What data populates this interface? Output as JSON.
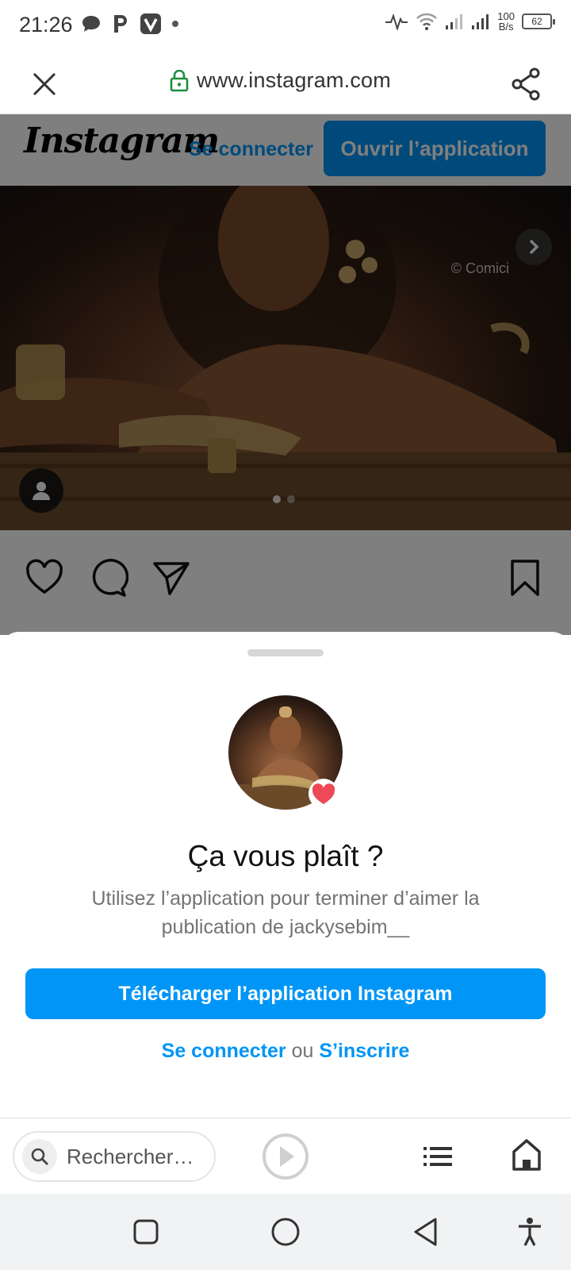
{
  "status_bar": {
    "time": "21:26",
    "net_speed_value": "100",
    "net_speed_unit": "B/s",
    "battery": "62"
  },
  "browser": {
    "url": "www.instagram.com",
    "icons": [
      "close-icon",
      "lock-icon",
      "share-icon"
    ]
  },
  "instagram_header": {
    "logo": "Instagram",
    "login_label": "Se connecter",
    "open_app_label": "Ouvrir l’application"
  },
  "post": {
    "credit": "© Comici",
    "carousel_pages": 2,
    "carousel_active": 1,
    "actions": [
      "heart-icon",
      "comment-icon",
      "send-icon",
      "bookmark-icon"
    ]
  },
  "sheet": {
    "title": "Ça vous plaît ?",
    "subtitle": "Utilisez l’application pour terminer d’aimer la publication de jackysebim__",
    "download_label": "Télécharger l’application Instagram",
    "login_link": "Se connecter",
    "or_text": "ou",
    "signup_link": "S’inscrire"
  },
  "toolbar": {
    "search_placeholder": "Rechercher…"
  },
  "colors": {
    "accent": "#0095f6",
    "heart": "#ed4956"
  }
}
